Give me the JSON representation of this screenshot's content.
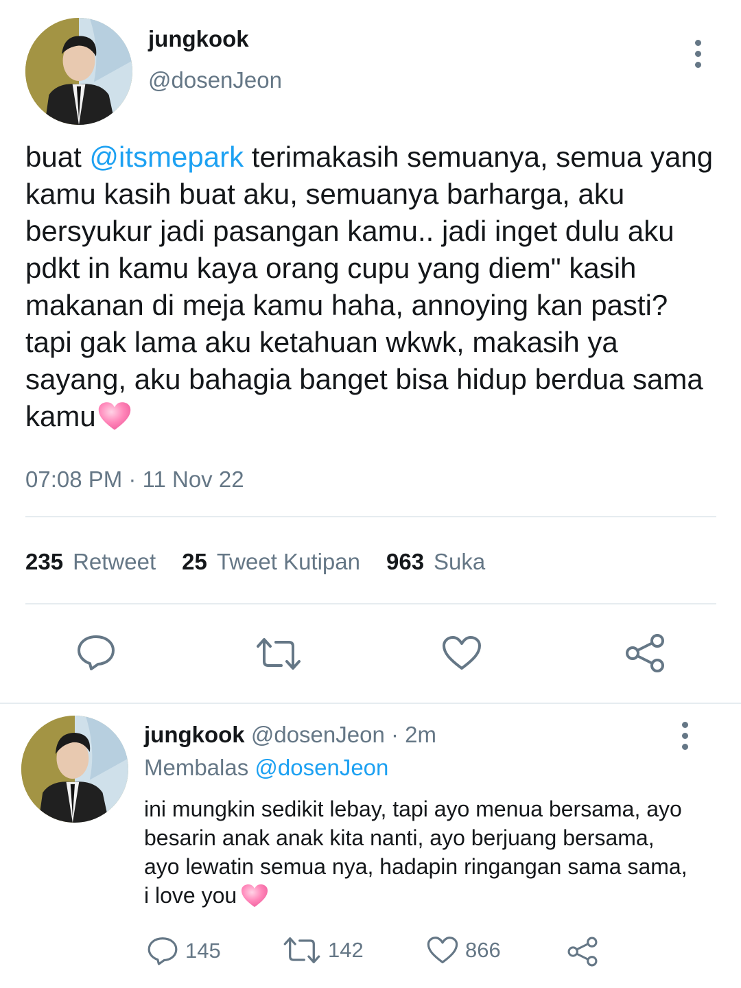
{
  "tweet": {
    "author_name": "jungkook",
    "author_handle": "@dosenJeon",
    "text_prefix": "buat ",
    "mention": "@itsmepark",
    "text_body": " terimakasih semuanya, semua yang kamu kasih buat aku, semuanya barharga, aku bersyukur jadi pasangan kamu.. jadi inget dulu aku pdkt in kamu kaya orang cupu yang diem\" kasih makanan di meja kamu haha, annoying kan pasti? tapi gak lama aku ketahuan wkwk, makasih ya sayang, aku bahagia banget bisa hidup berdua sama kamu",
    "emoji": "pink-heart",
    "timestamp": "07:08 PM · 11 Nov 22",
    "stats": {
      "retweet_count": "235",
      "retweet_label": "Retweet",
      "quote_count": "25",
      "quote_label": "Tweet Kutipan",
      "like_count": "963",
      "like_label": "Suka"
    },
    "actions": [
      "reply-icon",
      "retweet-icon",
      "like-icon",
      "share-icon"
    ]
  },
  "reply": {
    "author_name": "jungkook",
    "author_handle": "@dosenJeon",
    "separator": "·",
    "time": "2m",
    "replying_label": "Membalas",
    "replying_to": "@dosenJeon",
    "text": "ini mungkin sedikit lebay, tapi ayo menua bersama, ayo besarin anak anak kita nanti, ayo berjuang bersama, ayo lewatin semua nya, hadapin ringangan sama sama, i love you",
    "emoji": "pink-heart",
    "counts": {
      "replies": "145",
      "retweets": "142",
      "likes": "866"
    }
  },
  "colors": {
    "accent": "#1da1f2",
    "secondary_text": "#657786",
    "divider": "#e6ecf0"
  }
}
